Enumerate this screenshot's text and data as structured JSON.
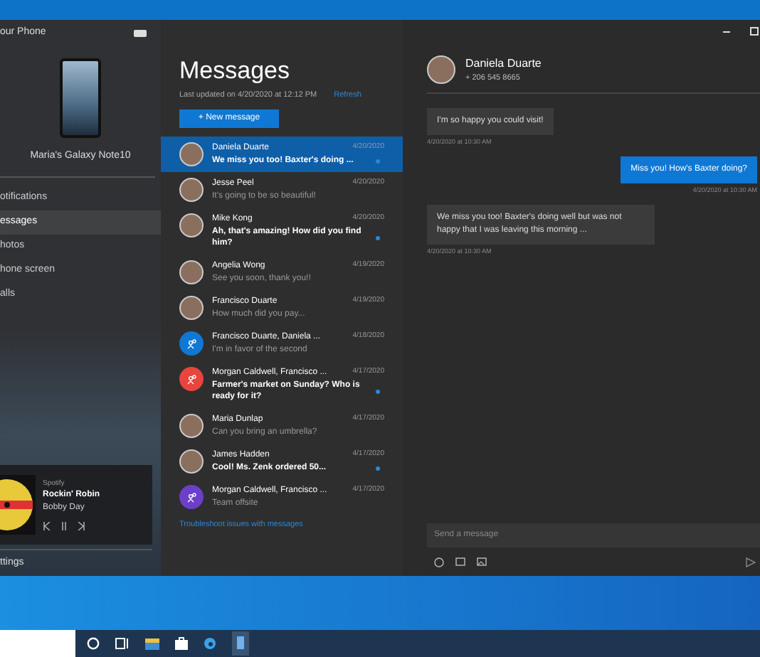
{
  "window": {
    "title": "our Phone"
  },
  "phone": {
    "name": "Maria's Galaxy Note10"
  },
  "nav": [
    {
      "label": "otifications",
      "selected": false
    },
    {
      "label": "essages",
      "selected": true
    },
    {
      "label": "hotos",
      "selected": false
    },
    {
      "label": "hone screen",
      "selected": false
    },
    {
      "label": "alls",
      "selected": false
    }
  ],
  "music": {
    "app": "Spotify",
    "track": "Rockin' Robin",
    "artist": "Bobby Day"
  },
  "settings": {
    "label": "ttings"
  },
  "messages": {
    "title": "Messages",
    "updated": "Last updated on 4/20/2020 at 12:12 PM",
    "refresh": "Refresh",
    "new_button": "+ New message",
    "troubleshoot": "Troubleshoot issues with messages"
  },
  "conversations": [
    {
      "name": "Daniela Duarte",
      "date": "4/20/2020",
      "preview": "We miss you too! Baxter's doing ...",
      "unread": true,
      "selected": true,
      "kind": "photo"
    },
    {
      "name": "Jesse Peel",
      "date": "4/20/2020",
      "preview": "It's going to be so beautiful!",
      "unread": false,
      "selected": false,
      "kind": "photo"
    },
    {
      "name": "Mike Kong",
      "date": "4/20/2020",
      "preview": "Ah, that's amazing! How did you find him?",
      "unread": true,
      "selected": false,
      "kind": "photo"
    },
    {
      "name": "Angelia Wong",
      "date": "4/19/2020",
      "preview": "See you soon, thank you!!",
      "unread": false,
      "selected": false,
      "kind": "photo"
    },
    {
      "name": "Francisco Duarte",
      "date": "4/19/2020",
      "preview": "How much did you pay...",
      "unread": false,
      "selected": false,
      "kind": "photo"
    },
    {
      "name": "Francisco Duarte, Daniela ...",
      "date": "4/18/2020",
      "preview": "I'm in favor of the second",
      "unread": false,
      "selected": false,
      "kind": "group",
      "color": "#0f78d4"
    },
    {
      "name": "Morgan Caldwell, Francisco ...",
      "date": "4/17/2020",
      "preview": "Farmer's market on Sunday? Who is ready for it?",
      "unread": true,
      "selected": false,
      "kind": "group",
      "color": "#e8453c"
    },
    {
      "name": "Maria Dunlap",
      "date": "4/17/2020",
      "preview": "Can you bring an umbrella?",
      "unread": false,
      "selected": false,
      "kind": "photo"
    },
    {
      "name": "James Hadden",
      "date": "4/17/2020",
      "preview": "Cool! Ms. Zenk ordered 50...",
      "unread": true,
      "selected": false,
      "kind": "photo"
    },
    {
      "name": "Morgan Caldwell, Francisco ...",
      "date": "4/17/2020",
      "preview": "Team offsite",
      "unread": false,
      "selected": false,
      "kind": "group",
      "color": "#6b3fc8"
    }
  ],
  "chat": {
    "name": "Daniela Duarte",
    "phone": "+ 206 545 8665",
    "placeholder": "Send a message",
    "bubbles": [
      {
        "text": "I'm so happy you could visit!",
        "time": "4/20/2020 at 10:30 AM",
        "outgoing": false
      },
      {
        "text": "Miss you! How's Baxter doing?",
        "time": "4/20/2020 at 10:30 AM",
        "outgoing": true
      },
      {
        "text": "We miss you too! Baxter's doing well but was not happy that I was leaving this morning ...",
        "time": "4/20/2020 at 10:30 AM",
        "outgoing": false
      }
    ]
  }
}
